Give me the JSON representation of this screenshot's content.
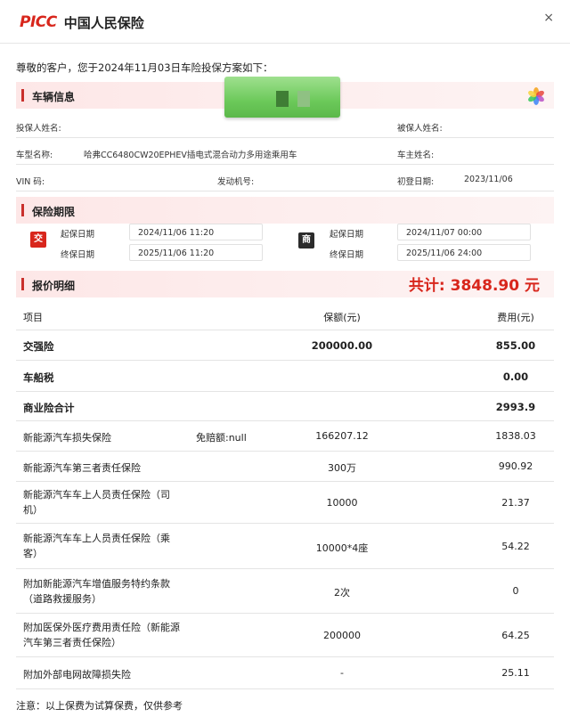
{
  "header": {
    "logo_mark": "PICC",
    "logo_name": "中国人民保险",
    "close_label": "×"
  },
  "greeting": "尊敬的客户，您于2024年11月03日车险投保方案如下：",
  "vehicle": {
    "section_title": "车辆信息",
    "applicant_label": "投保人姓名:",
    "insured_label": "被保人姓名:",
    "model_label": "车型名称:",
    "model_value": "哈弗CC6480CW20EPHEV插电式混合动力多用途乘用车",
    "owner_label": "车主姓名:",
    "vin_label": "VIN 码:",
    "engine_label": "发动机号:",
    "reg_label": "初登日期:",
    "reg_value": "2023/11/06"
  },
  "period": {
    "section_title": "保险期限",
    "compulsory_badge": "交",
    "commercial_badge": "商",
    "start_label": "起保日期",
    "end_label": "终保日期",
    "compulsory_start": "2024/11/06 11:20",
    "compulsory_end": "2025/11/06 11:20",
    "commercial_start": "2024/11/07 00:00",
    "commercial_end": "2025/11/06 24:00"
  },
  "quote": {
    "section_title": "报价明细",
    "total": "共计: 3848.90 元",
    "col_item": "项目",
    "col_amount": "保额(元)",
    "col_fee": "费用(元)",
    "rows": [
      {
        "name": "交强险",
        "extra": "",
        "amount": "200000.00",
        "fee": "855.00"
      },
      {
        "name": "车船税",
        "extra": "",
        "amount": "",
        "fee": "0.00"
      },
      {
        "name": "商业险合计",
        "extra": "",
        "amount": "",
        "fee": "2993.9"
      },
      {
        "name": "新能源汽车损失保险",
        "extra": "免赔额:null",
        "amount": "166207.12",
        "fee": "1838.03"
      },
      {
        "name": "新能源汽车第三者责任保险",
        "extra": "",
        "amount": "300万",
        "fee": "990.92"
      },
      {
        "name1": "新能源汽车车上人员责任保险（司",
        "name2": "机）",
        "amount": "10000",
        "fee": "21.37"
      },
      {
        "name1": "新能源汽车车上人员责任保险（乘",
        "name2": "客）",
        "amount": "10000*4座",
        "fee": "54.22"
      },
      {
        "name1": "附加新能源汽车增值服务特约条款",
        "name2": "（道路救援服务）",
        "amount": "2次",
        "fee": "0"
      },
      {
        "name1": "附加医保外医疗费用责任险（新能源",
        "name2": "汽车第三者责任保险）",
        "amount": "200000",
        "fee": "64.25"
      },
      {
        "name": "附加外部电网故障损失险",
        "extra": "",
        "amount": "-",
        "fee": "25.11"
      }
    ]
  },
  "note": "注意：以上保费为试算保费，仅供参考",
  "colors": {
    "brand_red": "#d8261c",
    "section_bg": "#fde7e7",
    "watermark_green": "#6cc95a"
  }
}
